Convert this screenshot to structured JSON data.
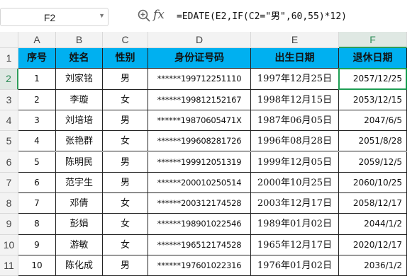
{
  "formula_bar": {
    "name_box": "F2",
    "fx_label": "fx",
    "formula": "=EDATE(E2,IF(C2=\"男\",60,55)*12)"
  },
  "columns": [
    "A",
    "B",
    "C",
    "D",
    "E",
    "F"
  ],
  "selected_column": "F",
  "rows": [
    "1",
    "2",
    "3",
    "4",
    "5",
    "6",
    "7",
    "8",
    "9",
    "10",
    "11"
  ],
  "selected_row": "2",
  "table": {
    "headers": [
      "序号",
      "姓名",
      "性别",
      "身份证号码",
      "出生日期",
      "退休日期"
    ],
    "records": [
      [
        "1",
        "刘家铭",
        "男",
        "******199712251110",
        "1997年12月25日",
        "2057/12/25"
      ],
      [
        "2",
        "李璇",
        "女",
        "******199812152167",
        "1998年12月15日",
        "2053/12/15"
      ],
      [
        "3",
        "刘培培",
        "男",
        "******19870605471X",
        "1987年06月05日",
        "2047/6/5"
      ],
      [
        "4",
        "张艳群",
        "女",
        "******199608281726",
        "1996年08月28日",
        "2051/8/28"
      ],
      [
        "5",
        "陈明民",
        "男",
        "******199912051319",
        "1999年12月05日",
        "2059/12/5"
      ],
      [
        "6",
        "范宇生",
        "男",
        "******200010250514",
        "2000年10月25日",
        "2060/10/25"
      ],
      [
        "7",
        "邓倩",
        "女",
        "******200312174528",
        "2003年12月17日",
        "2058/12/17"
      ],
      [
        "8",
        "彭娟",
        "女",
        "******198901022546",
        "1989年01月02日",
        "2044/1/2"
      ],
      [
        "9",
        "游敏",
        "女",
        "******196512174528",
        "1965年12月17日",
        "2020/12/17"
      ],
      [
        "10",
        "陈化成",
        "男",
        "******197601022316",
        "1976年01月02日",
        "2036/1/2"
      ]
    ]
  },
  "colors": {
    "header_fill": "#00b0f0",
    "selection": "#1e9e54"
  }
}
